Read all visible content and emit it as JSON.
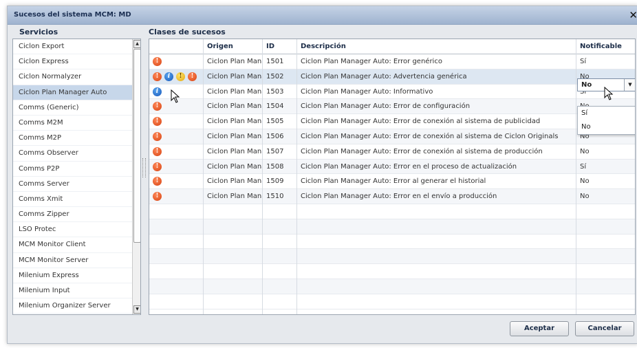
{
  "window": {
    "title": "Sucesos del sistema MCM: MD"
  },
  "services": {
    "label": "Servicios",
    "selected": "Ciclon Plan Manager Auto",
    "items": [
      "Ciclon Export",
      "Ciclon Express",
      "Ciclon Normalyzer",
      "Ciclon Plan Manager Auto",
      "Comms (Generic)",
      "Comms M2M",
      "Comms M2P",
      "Comms Observer",
      "Comms P2P",
      "Comms Server",
      "Comms Xmit",
      "Comms Zipper",
      "LSO Protec",
      "MCM Monitor Client",
      "MCM Monitor Server",
      "Milenium Express",
      "Milenium Input",
      "Milenium Organizer Server"
    ]
  },
  "events": {
    "label": "Clases de sucesos",
    "columns": {
      "icon": "",
      "origin": "Origen",
      "id": "ID",
      "description": "Descripción",
      "notify": "Notificable"
    },
    "rows": [
      {
        "icon": "error",
        "origin": "Ciclon Plan Manac",
        "id": "1501",
        "description": "Ciclon Plan Manager Auto: Error genérico",
        "notify": "Sí"
      },
      {
        "icon": "picker",
        "origin": "Ciclon Plan Manac",
        "id": "1502",
        "description": "Ciclon Plan Manager Auto: Advertencia genérica",
        "notify": "No"
      },
      {
        "icon": "info",
        "origin": "Ciclon Plan Manac",
        "id": "1503",
        "description": "Ciclon Plan Manager Auto: Informativo",
        "notify": "Sí"
      },
      {
        "icon": "error",
        "origin": "Ciclon Plan Manac",
        "id": "1504",
        "description": "Ciclon Plan Manager Auto: Error de configuración",
        "notify": "No"
      },
      {
        "icon": "error",
        "origin": "Ciclon Plan Manac",
        "id": "1505",
        "description": "Ciclon Plan Manager Auto: Error de conexión al sistema de publicidad",
        "notify": "No"
      },
      {
        "icon": "error",
        "origin": "Ciclon Plan Manac",
        "id": "1506",
        "description": "Ciclon Plan Manager Auto: Error de conexión al sistema de Ciclon Originals",
        "notify": "No"
      },
      {
        "icon": "error",
        "origin": "Ciclon Plan Manac",
        "id": "1507",
        "description": "Ciclon Plan Manager Auto: Error de conexión al sistema de producción",
        "notify": "No"
      },
      {
        "icon": "error",
        "origin": "Ciclon Plan Manac",
        "id": "1508",
        "description": "Ciclon Plan Manager Auto: Error en el proceso de actualización",
        "notify": "Sí"
      },
      {
        "icon": "error",
        "origin": "Ciclon Plan Manac",
        "id": "1509",
        "description": "Ciclon Plan Manager Auto: Error al generar el historial",
        "notify": "No"
      },
      {
        "icon": "error",
        "origin": "Ciclon Plan Manac",
        "id": "1510",
        "description": "Ciclon Plan Manager Auto: Error en el envío a producción",
        "notify": "No"
      }
    ],
    "notify_dropdown": {
      "value": "No",
      "options": [
        "Sí",
        "No"
      ]
    }
  },
  "buttons": {
    "accept": "Aceptar",
    "cancel": "Cancelar"
  },
  "icons": {
    "error": "error-icon",
    "info": "info-icon",
    "warning": "warning-icon",
    "close": "close-icon"
  },
  "colors": {
    "selected_row": "#c7d7ea",
    "titlebar": "#9fb3cf",
    "error": "#d6400f",
    "info": "#1655b8",
    "warning": "#e4a80e"
  }
}
